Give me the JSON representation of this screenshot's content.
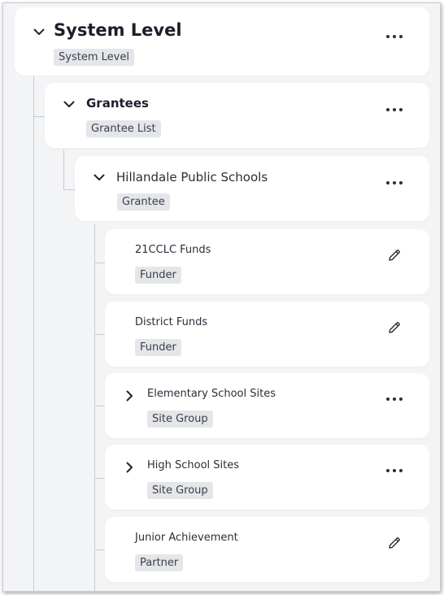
{
  "tree": {
    "root": {
      "title": "System Level",
      "tag": "System Level",
      "expanded": true,
      "action_icon": "more-icon"
    },
    "grantees": {
      "title": "Grantees",
      "tag": "Grantee List",
      "expanded": true,
      "action_icon": "more-icon"
    },
    "grantee": {
      "title": "Hillandale Public Schools",
      "tag": "Grantee",
      "expanded": true,
      "action_icon": "more-icon"
    },
    "children": [
      {
        "title": "21CCLC Funds",
        "tag": "Funder",
        "action_icon": "pencil-icon"
      },
      {
        "title": "District Funds",
        "tag": "Funder",
        "action_icon": "pencil-icon"
      },
      {
        "title": "Elementary School Sites",
        "tag": "Site Group",
        "expanded": false,
        "action_icon": "more-icon"
      },
      {
        "title": "High School Sites",
        "tag": "Site Group",
        "expanded": false,
        "action_icon": "more-icon"
      },
      {
        "title": "Junior Achievement",
        "tag": "Partner",
        "action_icon": "pencil-icon"
      }
    ]
  },
  "colors": {
    "background": "#f3f4f6",
    "card": "#ffffff",
    "tag_bg": "#e4e6ea",
    "connector": "#c8ccd2",
    "text": "#1f2430"
  }
}
